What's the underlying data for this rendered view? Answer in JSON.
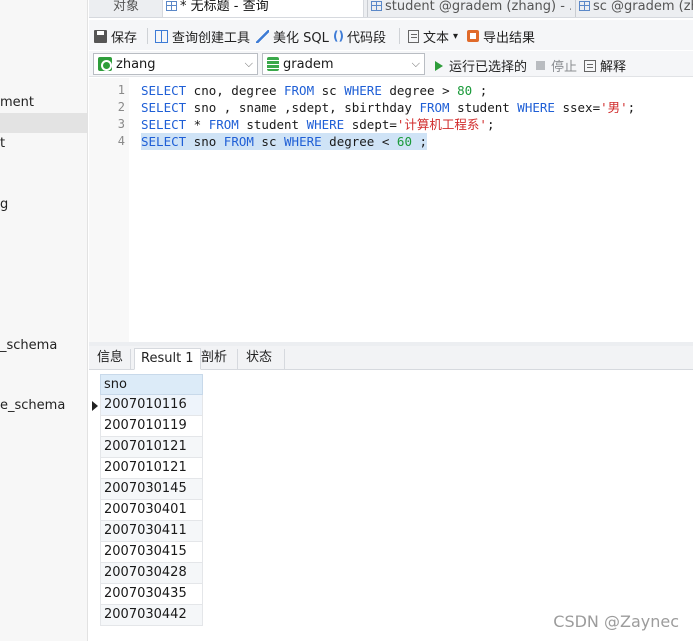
{
  "sidebar": {
    "items": [
      {
        "label": "ment"
      },
      {
        "label": "t"
      },
      {
        "label": ""
      },
      {
        "label": "g"
      },
      {
        "label": "_schema"
      },
      {
        "label": "e_schema"
      }
    ]
  },
  "tabs": {
    "objects": "对象",
    "query": "* 无标题 - 查询",
    "student": "student @gradem (zhang) - ...",
    "sc": "sc @gradem (zh"
  },
  "toolbar": {
    "save": "保存",
    "query_builder": "查询创建工具",
    "beautify": "美化 SQL",
    "snippet_icon": "()",
    "snippet": "代码段",
    "text": "文本",
    "text_caret": "▾",
    "export": "导出结果"
  },
  "connbar": {
    "connection": "zhang",
    "database": "gradem",
    "run_selected": "运行已选择的",
    "stop": "停止",
    "explain": "解释"
  },
  "editor": {
    "line_numbers": [
      "1",
      "2",
      "3",
      "4"
    ],
    "lines": [
      {
        "t1": "SELECT",
        "t2": " cno, degree ",
        "t3": "FROM",
        "t4": " sc ",
        "t5": "WHERE",
        "t6": " degree > ",
        "t7": "80",
        "t8": " ;"
      },
      {
        "t1": "SELECT",
        "t2": " sno , sname ,sdept, sbirthday ",
        "t3": "FROM",
        "t4": " student ",
        "t5": "WHERE",
        "t6": " ssex=",
        "t7": "'男'",
        "t8": ";"
      },
      {
        "t1": "SELECT",
        "t2": " * ",
        "t3": "FROM",
        "t4": " student ",
        "t5": "WHERE",
        "t6": " sdept=",
        "t7": "'计算机工程系'",
        "t8": ";"
      },
      {
        "t1": "SELECT",
        "t2": " sno ",
        "t3": "FROM",
        "t4": " sc ",
        "t5": "WHERE",
        "t6": " degree < ",
        "t7": "60",
        "t8": " ;"
      }
    ]
  },
  "result_tabs": [
    "信息",
    "Result 1",
    "剖析",
    "状态"
  ],
  "result": {
    "column": "sno",
    "rows": [
      "2007010116",
      "2007010119",
      "2007010121",
      "2007010121",
      "2007030145",
      "2007030401",
      "2007030411",
      "2007030415",
      "2007030428",
      "2007030435",
      "2007030442"
    ]
  },
  "watermark": "CSDN @Zaynec",
  "colors": {
    "keyword": "#1f5fd6",
    "number": "#1a9a3a",
    "string": "#d12c2c",
    "selection": "#cfe3f6",
    "header": "#dcebf8"
  }
}
